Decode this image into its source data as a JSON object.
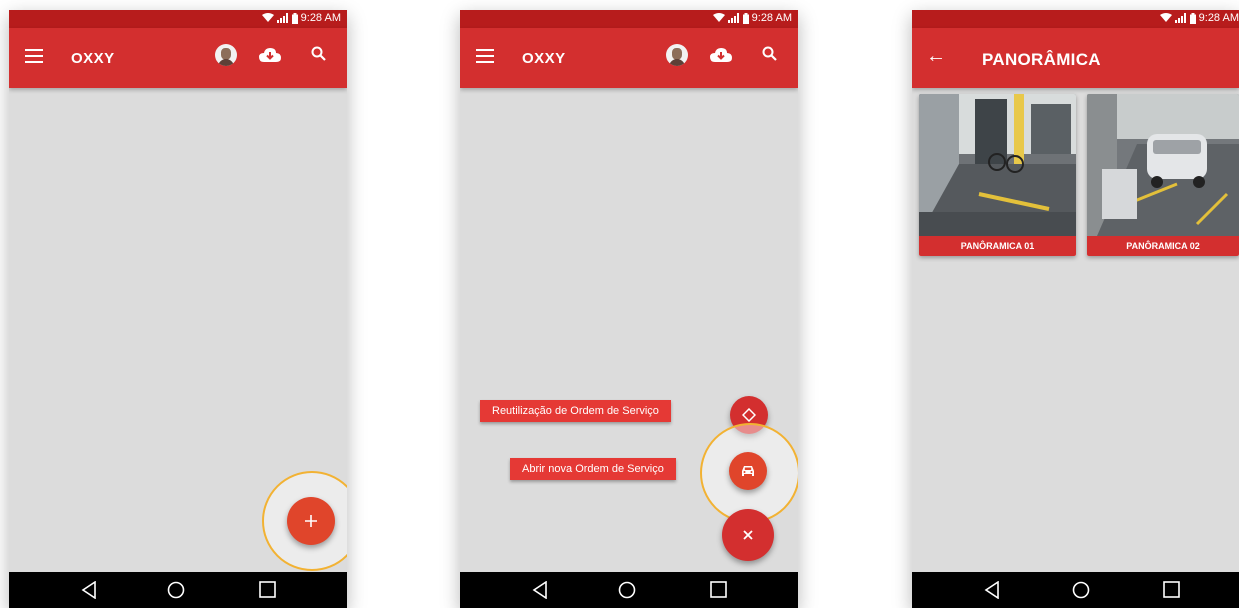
{
  "status": {
    "time": "9:28 AM"
  },
  "screen1": {
    "title": "OXXY",
    "fab_icon": "plus-icon"
  },
  "screen2": {
    "title": "OXXY",
    "actions": [
      {
        "label": "Reutilização de Ordem de Serviço",
        "icon": "diamond-icon"
      },
      {
        "label": "Abrir nova Ordem de Serviço",
        "icon": "car-icon"
      }
    ],
    "close_icon": "close-icon"
  },
  "screen3": {
    "title": "PANORÂMICA",
    "cards": [
      {
        "caption": "PANÔRAMICA 01"
      },
      {
        "caption": "PANÔRAMICA 02"
      }
    ]
  },
  "colors": {
    "primary": "#d32f2f",
    "status": "#b71c1c",
    "highlight": "#f2b233",
    "background": "#dcdcdc"
  }
}
